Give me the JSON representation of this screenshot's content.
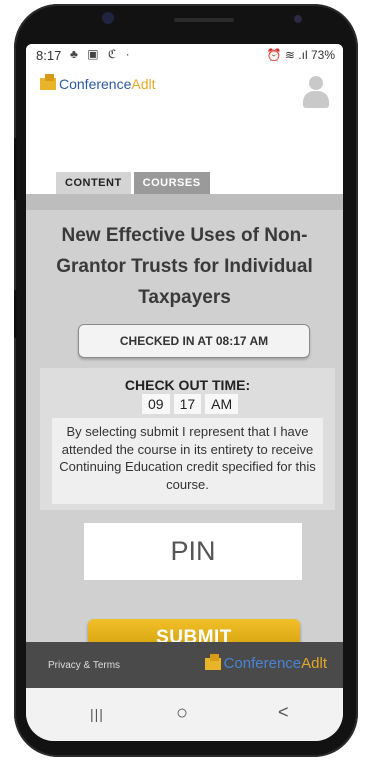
{
  "status_bar": {
    "time": "8:17",
    "notification_icons": "♣ ▣ ℭ ·",
    "right": "⏰ ≋ .ıl 73%"
  },
  "header": {
    "logo_conference": "Conference",
    "logo_adlt": "Adlt"
  },
  "tabs": [
    {
      "label": "CONTENT"
    },
    {
      "label": "COURSES"
    }
  ],
  "course": {
    "title": "New Effective Uses of Non-Grantor Trusts for Individual Taxpayers"
  },
  "checkin": {
    "label": "CHECKED IN AT 08:17 AM"
  },
  "checkout": {
    "label": "CHECK OUT TIME:",
    "hour": "09",
    "minute": "17",
    "ampm": "AM",
    "disclaimer": "By selecting submit I represent that I have attended the course in its entirety to receive Continuing Education credit specified for this course."
  },
  "pin": {
    "placeholder": "PIN"
  },
  "submit": {
    "label": "SUBMIT"
  },
  "footer": {
    "privacy": "Privacy & Terms",
    "logo_conference": "Conference",
    "logo_adlt": "Adlt"
  },
  "nav": {
    "recents": "|||",
    "home": "○",
    "back": "<"
  },
  "colors": {
    "accent_gold": "#e0ad12",
    "brand_blue": "#2a5aa8",
    "footer_bg": "#4a4a4a"
  }
}
